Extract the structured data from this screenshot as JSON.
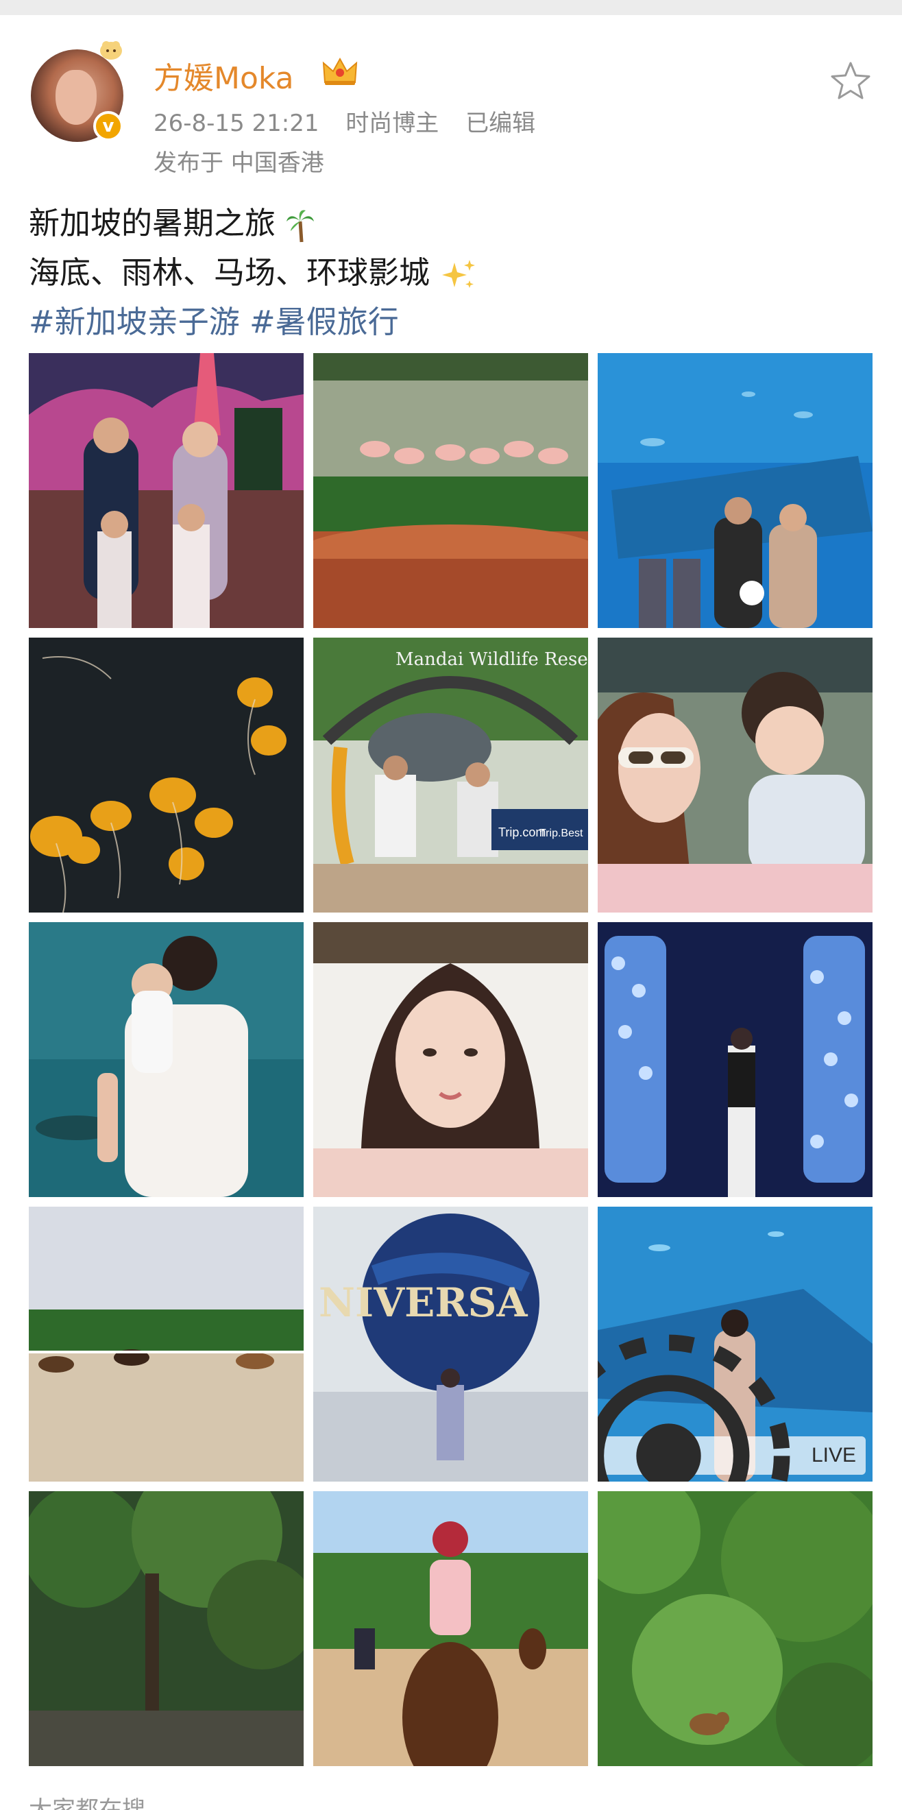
{
  "post": {
    "author": {
      "name": "方媛Moka",
      "avatar_icon": "user-avatar",
      "badge_icon": "crown-icon",
      "verified_label": "v"
    },
    "meta": {
      "date": "26-8-15 21:21",
      "category": "时尚博主",
      "edited": "已编辑",
      "location": "发布于 中国香港"
    },
    "favorite_icon": "star-icon",
    "text": {
      "line1": "新加坡的暑期之旅",
      "line1_emoji": "palm-tree-icon",
      "line2": "海底、雨林、马场、环球影城",
      "line2_emoji": "sparkles-icon",
      "hashtags": [
        "#新加坡亲子游",
        "#暑假旅行"
      ]
    },
    "photos": [
      {
        "id": "family-night-park"
      },
      {
        "id": "flamingos"
      },
      {
        "id": "aquarium-family"
      },
      {
        "id": "jellyfish"
      },
      {
        "id": "wildlife-reserve-sign",
        "sign_text": "Mandai Wildlife Reserve",
        "sponsor_1": "Trip.com",
        "sponsor_2": "Trip.Best"
      },
      {
        "id": "mother-baby-selfie"
      },
      {
        "id": "father-child-aquarium"
      },
      {
        "id": "portrait-selfie"
      },
      {
        "id": "light-installation"
      },
      {
        "id": "horse-field"
      },
      {
        "id": "universal-globe",
        "sign_text": "NIVERSA"
      },
      {
        "id": "aquarium-woman",
        "live_label": "LIVE"
      },
      {
        "id": "rainforest"
      },
      {
        "id": "horse-riding-trail"
      },
      {
        "id": "jungle-monkey"
      }
    ],
    "footer_text": "大家都在搜"
  },
  "colors": {
    "username": "#e4882b",
    "hashtag": "#4a6a96",
    "meta": "#8a8a8a",
    "badge": "#f2a500"
  }
}
